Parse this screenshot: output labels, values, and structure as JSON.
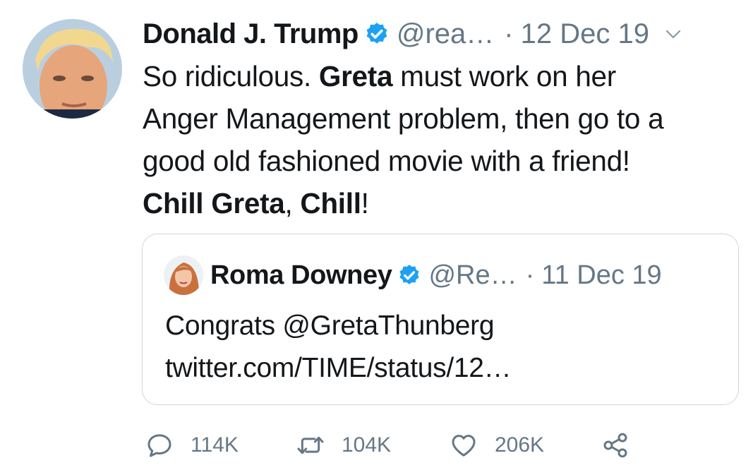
{
  "tweet": {
    "author_name": "Donald J. Trump",
    "handle": "@rea…",
    "separator": "·",
    "date": "12 Dec 19",
    "lines": [
      [
        {
          "text": "So ridiculous. ",
          "bold": false
        },
        {
          "text": "Greta",
          "bold": true
        },
        {
          "text": " must work on her",
          "bold": false
        }
      ],
      [
        {
          "text": "Anger Management problem, then go to a",
          "bold": false
        }
      ],
      [
        {
          "text": "good old fashioned movie with a friend!",
          "bold": false
        }
      ],
      [
        {
          "text": "Chill Greta",
          "bold": true
        },
        {
          "text": ", ",
          "bold": false
        },
        {
          "text": "Chill",
          "bold": true
        },
        {
          "text": "!",
          "bold": false
        }
      ]
    ]
  },
  "quoted_tweet": {
    "author_name": "Roma Downey",
    "handle": "@Re…",
    "separator": "·",
    "date": "11 Dec 19",
    "line1": "Congrats @GretaThunberg",
    "line2": "twitter.com/TIME/status/12…"
  },
  "actions": {
    "reply_count": "114K",
    "retweet_count": "104K",
    "like_count": "206K"
  },
  "icons": {
    "verified": "verified-badge-icon",
    "caret": "chevron-down-icon",
    "reply": "reply-icon",
    "retweet": "retweet-icon",
    "like": "heart-icon",
    "share": "share-icon"
  },
  "colors": {
    "verified_blue": "#1da1f2",
    "muted_gray": "#657786",
    "text": "#14171a",
    "border": "#ccd6dd"
  }
}
